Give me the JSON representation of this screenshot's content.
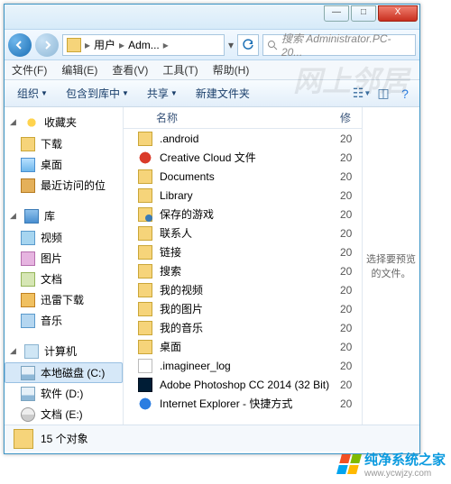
{
  "window": {
    "min": "—",
    "max": "□",
    "close": "X"
  },
  "breadcrumb": {
    "seg1": "用户",
    "seg2": "Adm...",
    "sep": "▸"
  },
  "search": {
    "placeholder": "搜索 Administrator.PC-20..."
  },
  "menu": {
    "file": "文件(F)",
    "edit": "编辑(E)",
    "view": "查看(V)",
    "tools": "工具(T)",
    "help": "帮助(H)"
  },
  "toolbar": {
    "organize": "组织",
    "include": "包含到库中",
    "share": "共享",
    "newfolder": "新建文件夹"
  },
  "nav": {
    "favorites": "收藏夹",
    "downloads": "下载",
    "desktop": "桌面",
    "recent": "最近访问的位",
    "libraries": "库",
    "videos": "视频",
    "pictures": "图片",
    "documents": "文档",
    "thunder": "迅雷下载",
    "music": "音乐",
    "computer": "计算机",
    "driveC": "本地磁盘 (C:)",
    "driveD": "软件 (D:)",
    "driveE": "文档 (E:)"
  },
  "columns": {
    "name": "名称",
    "modified": "修"
  },
  "files": [
    {
      "name": ".android",
      "icon": "folder",
      "mod": "20"
    },
    {
      "name": "Creative Cloud 文件",
      "icon": "cc",
      "mod": "20"
    },
    {
      "name": "Documents",
      "icon": "folder",
      "mod": "20"
    },
    {
      "name": "Library",
      "icon": "folder",
      "mod": "20"
    },
    {
      "name": "保存的游戏",
      "icon": "game",
      "mod": "20"
    },
    {
      "name": "联系人",
      "icon": "contact",
      "mod": "20"
    },
    {
      "name": "链接",
      "icon": "folder",
      "mod": "20"
    },
    {
      "name": "搜索",
      "icon": "srch",
      "mod": "20"
    },
    {
      "name": "我的视频",
      "icon": "folder",
      "mod": "20"
    },
    {
      "name": "我的图片",
      "icon": "folder",
      "mod": "20"
    },
    {
      "name": "我的音乐",
      "icon": "folder",
      "mod": "20"
    },
    {
      "name": "桌面",
      "icon": "folder",
      "mod": "20"
    },
    {
      "name": ".imagineer_log",
      "icon": "log",
      "mod": "20"
    },
    {
      "name": "Adobe Photoshop CC 2014 (32 Bit)",
      "icon": "ps",
      "mod": "20"
    },
    {
      "name": "Internet Explorer - 快捷方式",
      "icon": "ie",
      "mod": "20"
    }
  ],
  "preview": {
    "text": "选择要预览的文件。"
  },
  "status": {
    "text": "15 个对象"
  },
  "watermark": {
    "title": "纯净系统之家",
    "url": "www.ycwjzy.com"
  }
}
